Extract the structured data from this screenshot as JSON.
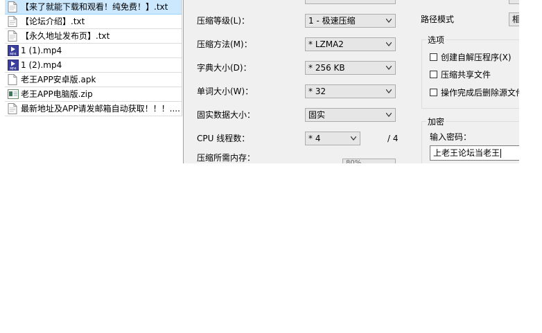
{
  "file_list": [
    {
      "name": "【来了就能下载和观看！纯免费！】.txt",
      "icon": "text-file-icon",
      "selected": true
    },
    {
      "name": "【论坛介绍】.txt",
      "icon": "text-file-icon",
      "selected": false
    },
    {
      "name": "【永久地址发布页】.txt",
      "icon": "text-file-icon",
      "selected": false
    },
    {
      "name": "1 (1).mp4",
      "icon": "mp4-file-icon",
      "selected": false
    },
    {
      "name": "1 (2).mp4",
      "icon": "mp4-file-icon",
      "selected": false
    },
    {
      "name": "老王APP安卓版.apk",
      "icon": "generic-file-icon",
      "selected": false
    },
    {
      "name": "老王APP电脑版.zip",
      "icon": "zip-file-icon",
      "selected": false
    },
    {
      "name": "最新地址及APP请发邮箱自动获取！！！....",
      "icon": "text-file-icon",
      "selected": false
    }
  ],
  "dialog": {
    "compression_level": {
      "label": "压缩等级(L)：",
      "value": "1 - 极速压缩"
    },
    "compression_method": {
      "label": "压缩方法(M)：",
      "value": "* LZMA2"
    },
    "dictionary_size": {
      "label": "字典大小(D)：",
      "value": "* 256 KB"
    },
    "word_size": {
      "label": "单词大小(W)：",
      "value": "* 32"
    },
    "solid_block_size": {
      "label": "固实数据大小：",
      "value": "固实"
    },
    "cpu_threads": {
      "label": "CPU 线程数：",
      "value": "* 4",
      "max": "/ 4"
    },
    "memory_usage": {
      "label": "压缩所需内存：",
      "value": "80%"
    },
    "path_mode": {
      "label": "路径模式",
      "value": "相"
    },
    "options": {
      "title": "选项",
      "items": [
        "创建自解压程序(X)",
        "压缩共享文件",
        "操作完成后删除源文件"
      ]
    },
    "encryption": {
      "title": "加密",
      "password_label": "输入密码：",
      "password_value": "上老王论坛当老王"
    }
  },
  "colors": {
    "selection": "#cce8ff",
    "dialog_bg": "#f0f0f0"
  }
}
